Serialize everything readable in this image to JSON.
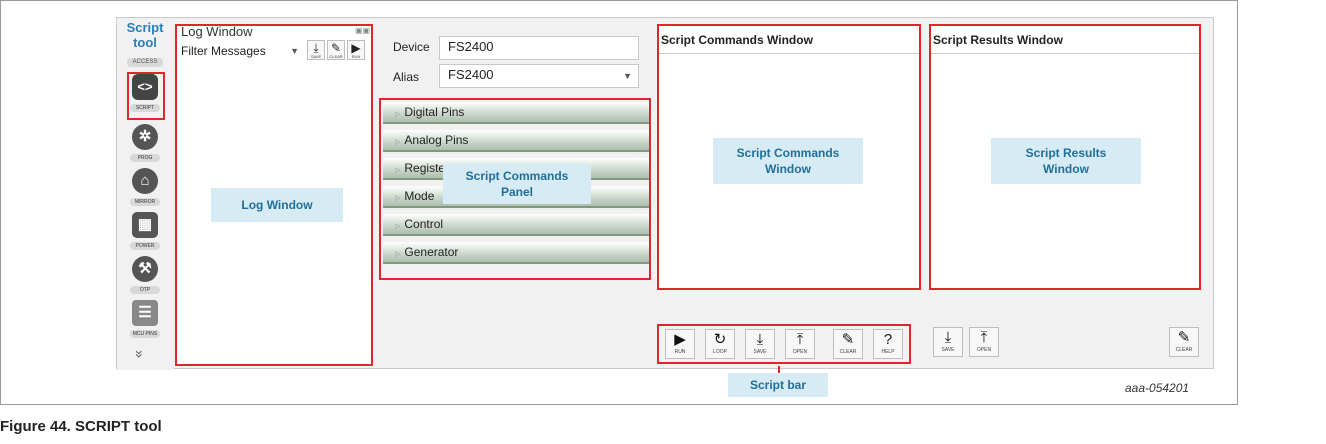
{
  "left_strip": {
    "title_line1": "Script",
    "title_line2": "tool",
    "access_label": "ACCESS",
    "tools": [
      {
        "icon": "code-icon",
        "glyph": "<>",
        "label": "SCRIPT"
      },
      {
        "icon": "gear-icon",
        "glyph": "✲",
        "label": "PROG"
      },
      {
        "icon": "mirror-icon",
        "glyph": "⌂",
        "label": "MIRROR"
      },
      {
        "icon": "calculator-icon",
        "glyph": "▦",
        "label": "POWER"
      },
      {
        "icon": "hammer-icon",
        "glyph": "⚒",
        "label": "OTP"
      },
      {
        "icon": "pins-icon",
        "glyph": "☰",
        "label": "MCU PINS"
      }
    ],
    "expand_glyph": "»"
  },
  "log_window": {
    "title": "Log Window",
    "filter_placeholder": "Filter Messages",
    "buttons": [
      {
        "icon": "save-icon",
        "glyph": "⤓",
        "label": "SAVE"
      },
      {
        "icon": "clear-icon",
        "glyph": "✎",
        "label": "CLEAR"
      },
      {
        "icon": "run-icon",
        "glyph": "▶",
        "label": "RUN"
      }
    ],
    "callout": "Log Window"
  },
  "device_panel": {
    "device_label": "Device",
    "device_value": "FS2400",
    "alias_label": "Alias",
    "alias_value": "FS2400",
    "sections": [
      "Digital Pins",
      "Analog Pins",
      "Register",
      "Mode",
      "Control",
      "Generator"
    ],
    "callout_line1": "Script Commands",
    "callout_line2": "Panel"
  },
  "commands_window": {
    "title": "Script Commands Window",
    "callout_line1": "Script Commands",
    "callout_line2": "Window",
    "buttons": [
      {
        "icon": "run-icon",
        "glyph": "▶",
        "label": "RUN"
      },
      {
        "icon": "loop-icon",
        "glyph": "↻",
        "label": "LOOP"
      },
      {
        "icon": "save-icon",
        "glyph": "⤓",
        "label": "SAVE"
      },
      {
        "icon": "open-icon",
        "glyph": "⤒",
        "label": "OPEN"
      },
      {
        "icon": "clear-icon",
        "glyph": "✎",
        "label": "CLEAR"
      },
      {
        "icon": "help-icon",
        "glyph": "?",
        "label": "HELP"
      }
    ],
    "bar_callout": "Script bar"
  },
  "results_window": {
    "title": "Script Results Window",
    "callout_line1": "Script Results",
    "callout_line2": "Window",
    "buttons": [
      {
        "icon": "save-icon",
        "glyph": "⤓",
        "label": "SAVE"
      },
      {
        "icon": "open-icon",
        "glyph": "⤒",
        "label": "OPEN"
      },
      {
        "icon": "clear-icon",
        "glyph": "✎",
        "label": "CLEAR"
      }
    ]
  },
  "figure_id": "aaa-054201",
  "caption": "Figure 44.  SCRIPT tool",
  "colors": {
    "highlight": "#e0252e",
    "callout_bg": "#d6ebf4",
    "callout_text": "#1f6f99",
    "accent": "#2a7fb8"
  }
}
